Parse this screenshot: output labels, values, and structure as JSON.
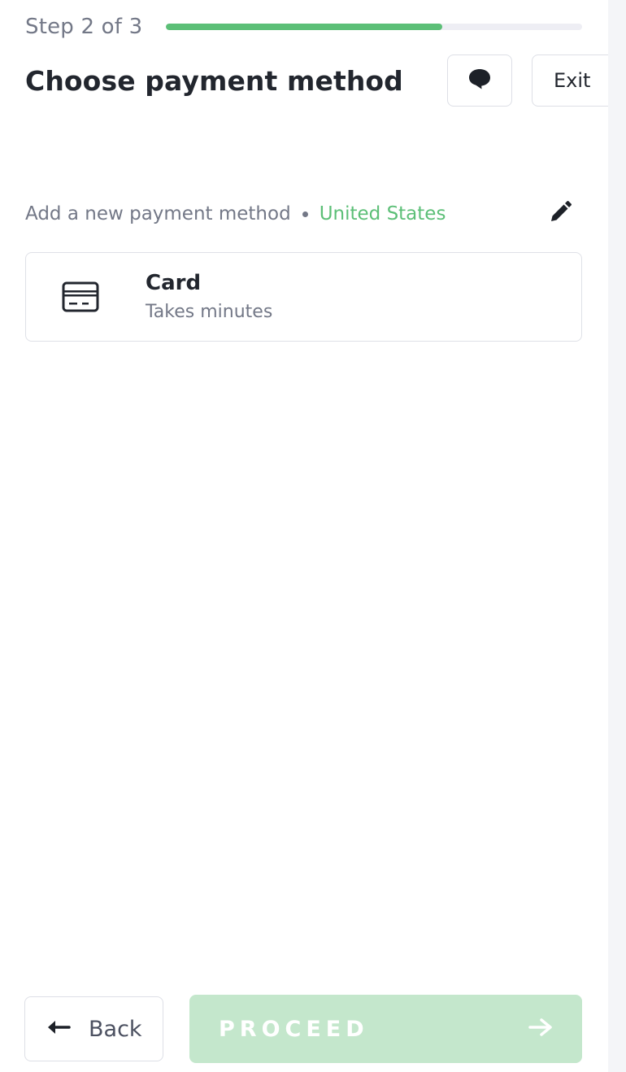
{
  "progress": {
    "step_label": "Step 2 of 3",
    "fraction": 0.665,
    "color": "#5cbf77"
  },
  "header": {
    "title": "Choose payment method",
    "chat_icon": "chat-bubble-icon",
    "exit_label": "Exit"
  },
  "section": {
    "label": "Add a new payment method",
    "country": "United States",
    "edit_icon": "pencil-icon"
  },
  "methods": [
    {
      "icon": "credit-card-icon",
      "name": "Card",
      "description": "Takes minutes"
    }
  ],
  "footer": {
    "back_label": "Back",
    "back_icon": "arrow-left-icon",
    "proceed_label": "PROCEED",
    "proceed_icon": "arrow-right-icon",
    "proceed_enabled": false,
    "proceed_color": "#c4e7cc"
  }
}
